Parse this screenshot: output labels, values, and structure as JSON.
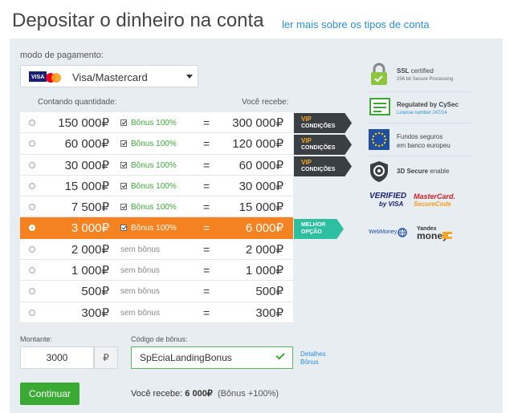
{
  "page": {
    "title": "Depositar o dinheiro na conta",
    "more_link": "ler mais sobre os tipos de conta"
  },
  "payment": {
    "label": "modo de pagamento:",
    "selected": "Visa/Mastercard"
  },
  "table": {
    "header_left": "Contando quantidade:",
    "header_right": "Você recebe:",
    "rows": [
      {
        "amount": "150 000₽",
        "bonus": "Bônus 100%",
        "eq": "=",
        "receive": "300 000₽"
      },
      {
        "amount": "60 000₽",
        "bonus": "Bônus 100%",
        "eq": "=",
        "receive": "120 000₽"
      },
      {
        "amount": "30 000₽",
        "bonus": "Bônus 100%",
        "eq": "=",
        "receive": "60 000₽"
      },
      {
        "amount": "15 000₽",
        "bonus": "Bônus 100%",
        "eq": "=",
        "receive": "30 000₽"
      },
      {
        "amount": "7 500₽",
        "bonus": "Bônus 100%",
        "eq": "=",
        "receive": "15 000₽"
      },
      {
        "amount": "3 000₽",
        "bonus": "Bônus 100%",
        "eq": "=",
        "receive": "6 000₽"
      },
      {
        "amount": "2 000₽",
        "bonus": "sem bônus",
        "eq": "=",
        "receive": "2 000₽"
      },
      {
        "amount": "1 000₽",
        "bonus": "sem bônus",
        "eq": "=",
        "receive": "1 000₽"
      },
      {
        "amount": "500₽",
        "bonus": "sem bônus",
        "eq": "=",
        "receive": "500₽"
      },
      {
        "amount": "300₽",
        "bonus": "sem bônus",
        "eq": "=",
        "receive": "300₽"
      }
    ],
    "vip_tag": {
      "line1": "VIP",
      "line2": "CONDIÇÕES"
    },
    "best_tag": {
      "line1": "MELHOR",
      "line2": "OPÇÃO"
    }
  },
  "trust": {
    "ssl_title": "SSL",
    "ssl_title_rest": "certified",
    "ssl_sub": "256 bit Secure Processing",
    "cysec_title": "Regulated by CySec",
    "cysec_sub": "License number 247/14",
    "eu_line1": "Fundos seguros",
    "eu_line2": "em banco europeu",
    "secure3d_bold": "3D Secure",
    "secure3d_rest": "enable",
    "verified_visa_line1": "VERIFIED",
    "verified_visa_line2": "by VISA",
    "mc_line1": "MasterCard.",
    "mc_line2": "SecureCode",
    "webmoney": "WebMoney",
    "yandex_line1": "Yandex",
    "yandex_line2": "money"
  },
  "form": {
    "amount_label": "Montante:",
    "amount_value": "3000",
    "currency": "₽",
    "code_label": "Código de bônus:",
    "code_value": "SpEciaLandingBonus",
    "details_line1": "Detalhes",
    "details_line2": "Bônus",
    "continue": "Continuar",
    "summary_label": "Você recebe:",
    "summary_value": "6 000₽",
    "summary_extra": "(Bônus +100%)"
  },
  "colors": {
    "accent_orange": "#f58220",
    "green": "#3aaa35",
    "link_blue": "#2b8fd6",
    "vip_dark": "#3a3f44",
    "best_teal": "#2dbfa0"
  }
}
